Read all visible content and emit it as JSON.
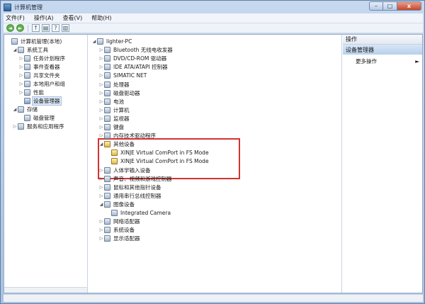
{
  "window": {
    "title": "计算机管理",
    "controls": {
      "minimize": "–",
      "maximize": "□",
      "close": "x"
    }
  },
  "menubar": [
    "文件(F)",
    "操作(A)",
    "查看(V)",
    "帮助(H)"
  ],
  "toolbar": {
    "back": "◄",
    "forward": "►",
    "up": "↑",
    "help": "?"
  },
  "tree_left": [
    {
      "label": "计算机管理(本地)",
      "indent": 0,
      "expander": "",
      "icon": "computer-management-icon"
    },
    {
      "label": "系统工具",
      "indent": 1,
      "expander": "◢",
      "icon": "tools-icon"
    },
    {
      "label": "任务计划程序",
      "indent": 2,
      "expander": "▷",
      "icon": "clock-icon"
    },
    {
      "label": "事件查看器",
      "indent": 2,
      "expander": "▷",
      "icon": "event-viewer-icon"
    },
    {
      "label": "共享文件夹",
      "indent": 2,
      "expander": "▷",
      "icon": "shared-folder-icon"
    },
    {
      "label": "本地用户和组",
      "indent": 2,
      "expander": "▷",
      "icon": "users-icon"
    },
    {
      "label": "性能",
      "indent": 2,
      "expander": "▷",
      "icon": "performance-icon"
    },
    {
      "label": "设备管理器",
      "indent": 2,
      "expander": "",
      "icon": "device-manager-icon",
      "selected": true
    },
    {
      "label": "存储",
      "indent": 1,
      "expander": "◢",
      "icon": "storage-icon"
    },
    {
      "label": "磁盘管理",
      "indent": 2,
      "expander": "",
      "icon": "disk-icon"
    },
    {
      "label": "服务和应用程序",
      "indent": 1,
      "expander": "▷",
      "icon": "services-icon"
    }
  ],
  "device_tree": [
    {
      "label": "lighter-PC",
      "indent": 0,
      "expander": "◢",
      "icon": "computer-icon"
    },
    {
      "label": "Bluetooth 无线电收发器",
      "indent": 1,
      "expander": "▷",
      "icon": "bluetooth-icon"
    },
    {
      "label": "DVD/CD-ROM 驱动器",
      "indent": 1,
      "expander": "▷",
      "icon": "dvd-icon"
    },
    {
      "label": "IDE ATA/ATAPI 控制器",
      "indent": 1,
      "expander": "▷",
      "icon": "ide-icon"
    },
    {
      "label": "SIMATIC NET",
      "indent": 1,
      "expander": "▷",
      "icon": "network-icon"
    },
    {
      "label": "处理器",
      "indent": 1,
      "expander": "▷",
      "icon": "processor-icon"
    },
    {
      "label": "磁盘驱动器",
      "indent": 1,
      "expander": "▷",
      "icon": "disk-drive-icon"
    },
    {
      "label": "电池",
      "indent": 1,
      "expander": "▷",
      "icon": "battery-icon"
    },
    {
      "label": "计算机",
      "indent": 1,
      "expander": "▷",
      "icon": "computer-icon"
    },
    {
      "label": "监视器",
      "indent": 1,
      "expander": "▷",
      "icon": "monitor-icon"
    },
    {
      "label": "键盘",
      "indent": 1,
      "expander": "▷",
      "icon": "keyboard-icon"
    },
    {
      "label": "内存技术驱动程序",
      "indent": 1,
      "expander": "▷",
      "icon": "memory-icon"
    },
    {
      "label": "其他设备",
      "indent": 1,
      "expander": "◢",
      "icon": "other-devices-icon",
      "warn": true
    },
    {
      "label": "XINJE Virtual ComPort in FS Mode",
      "indent": 2,
      "expander": "",
      "icon": "warning-device-icon",
      "warn": true
    },
    {
      "label": "XINJE Virtual ComPort in FS Mode",
      "indent": 2,
      "expander": "",
      "icon": "warning-device-icon",
      "warn": true
    },
    {
      "label": "人体学输入设备",
      "indent": 1,
      "expander": "▷",
      "icon": "hid-icon"
    },
    {
      "label": "声音、视频和游戏控制器",
      "indent": 1,
      "expander": "▷",
      "icon": "sound-icon"
    },
    {
      "label": "鼠标和其他指针设备",
      "indent": 1,
      "expander": "▷",
      "icon": "mouse-icon"
    },
    {
      "label": "通用串行总线控制器",
      "indent": 1,
      "expander": "▷",
      "icon": "usb-icon"
    },
    {
      "label": "图像设备",
      "indent": 1,
      "expander": "◢",
      "icon": "camera-icon"
    },
    {
      "label": "Integrated Camera",
      "indent": 2,
      "expander": "",
      "icon": "camera-icon"
    },
    {
      "label": "网络适配器",
      "indent": 1,
      "expander": "▷",
      "icon": "network-adapter-icon"
    },
    {
      "label": "系统设备",
      "indent": 1,
      "expander": "▷",
      "icon": "system-device-icon"
    },
    {
      "label": "显示适配器",
      "indent": 1,
      "expander": "▷",
      "icon": "display-adapter-icon"
    }
  ],
  "actions_pane": {
    "header": "操作",
    "section": "设备管理器",
    "more": "更多操作",
    "more_arrow": "►"
  },
  "colors": {
    "highlight_box": "#d63131",
    "selection": "#dde8f5"
  }
}
